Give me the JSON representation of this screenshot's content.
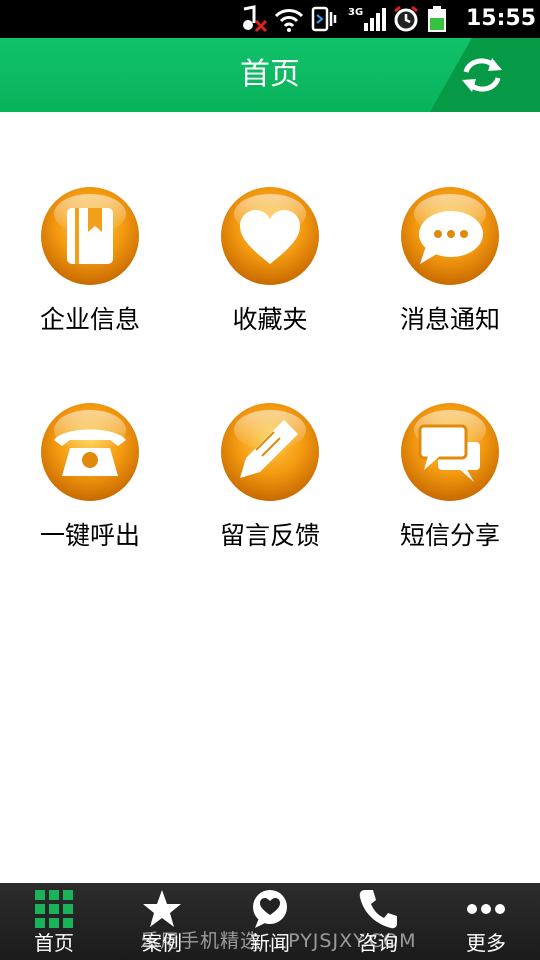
{
  "status_bar": {
    "time": "15:55",
    "network": "3G"
  },
  "header": {
    "title": "首页",
    "refresh_icon": "refresh-icon",
    "color": "#0ab862"
  },
  "grid": {
    "items": [
      {
        "label": "企业信息",
        "icon": "notebook-icon"
      },
      {
        "label": "收藏夹",
        "icon": "heart-icon"
      },
      {
        "label": "消息通知",
        "icon": "chat-bubble-icon"
      },
      {
        "label": "一键呼出",
        "icon": "telephone-icon"
      },
      {
        "label": "留言反馈",
        "icon": "pencil-icon"
      },
      {
        "label": "短信分享",
        "icon": "messages-icon"
      }
    ],
    "icon_color": "#f0960a"
  },
  "bottom_nav": {
    "items": [
      {
        "label": "首页",
        "icon": "grid-icon",
        "active": true
      },
      {
        "label": "案例",
        "icon": "star-icon"
      },
      {
        "label": "新闻",
        "icon": "heart-bubble-icon"
      },
      {
        "label": "咨询",
        "icon": "phone-icon"
      },
      {
        "label": "更多",
        "icon": "more-icon"
      }
    ],
    "active_color": "#19b35a"
  },
  "watermark": "乐用手机精选 .. PYJSJXY.COM"
}
